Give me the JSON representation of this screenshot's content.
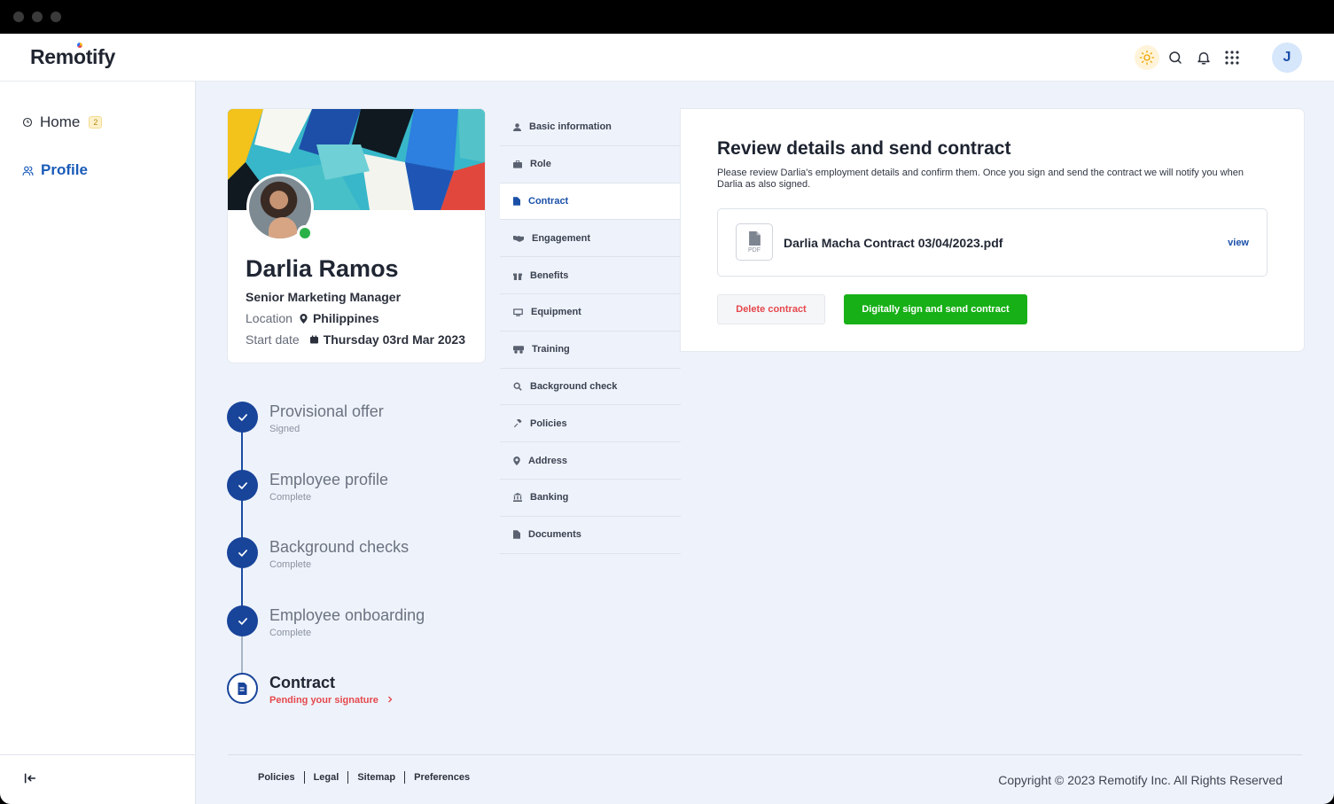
{
  "app": {
    "logo_text_pre": "Rem",
    "logo_text_o": "o",
    "logo_text_post": "tify"
  },
  "header": {
    "icons": [
      "sun-icon",
      "search-icon",
      "bell-icon",
      "apps-grid-icon"
    ],
    "user_initial": "J"
  },
  "sidebar": {
    "items": [
      {
        "label": "Home",
        "icon": "clock-icon",
        "badge": "2"
      },
      {
        "label": "Profile",
        "icon": "users-icon"
      }
    ],
    "collapse_icon": "collapse-left-icon"
  },
  "profile": {
    "name": "Darlia Ramos",
    "title": "Senior Marketing Manager",
    "location_label": "Location",
    "location_value": "Philippines",
    "start_label": "Start date",
    "start_value": "Thursday 03rd Mar 2023",
    "status": "online"
  },
  "timeline": [
    {
      "title": "Provisional offer",
      "status": "Signed"
    },
    {
      "title": "Employee profile",
      "status": "Complete"
    },
    {
      "title": "Background checks",
      "status": "Complete"
    },
    {
      "title": "Employee onboarding",
      "status": "Complete"
    },
    {
      "title": "Contract",
      "status": "Pending your signature"
    }
  ],
  "sections": [
    {
      "label": "Basic information",
      "icon": "user-icon"
    },
    {
      "label": "Role",
      "icon": "briefcase-icon"
    },
    {
      "label": "Contract",
      "icon": "document-icon",
      "active": true
    },
    {
      "label": "Engagement",
      "icon": "handshake-icon"
    },
    {
      "label": "Benefits",
      "icon": "gift-icon"
    },
    {
      "label": "Equipment",
      "icon": "monitor-icon"
    },
    {
      "label": "Training",
      "icon": "training-icon"
    },
    {
      "label": "Background check",
      "icon": "magnifier-icon"
    },
    {
      "label": "Policies",
      "icon": "gavel-icon"
    },
    {
      "label": "Address",
      "icon": "pin-icon"
    },
    {
      "label": "Banking",
      "icon": "bank-icon"
    },
    {
      "label": "Documents",
      "icon": "file-icon"
    }
  ],
  "panel": {
    "title": "Review details and send contract",
    "description": "Please review Darlia's employment details and confirm them. Once you sign and send the contract we will notify you when Darlia as also signed.",
    "file_type": "PDF",
    "file_name": "Darlia Macha Contract 03/04/2023.pdf",
    "view_label": "view",
    "delete_label": "Delete contract",
    "sign_label": "Digitally sign and send contract"
  },
  "footer": {
    "links": [
      "Policies",
      "Legal",
      "Sitemap",
      "Preferences"
    ],
    "copyright": "Copyright © 2023 Remotify Inc. All Rights Reserved"
  },
  "colors": {
    "accent": "#1a4fa8",
    "success": "#17b017",
    "danger": "#e5484d",
    "background": "#eef3fb"
  }
}
